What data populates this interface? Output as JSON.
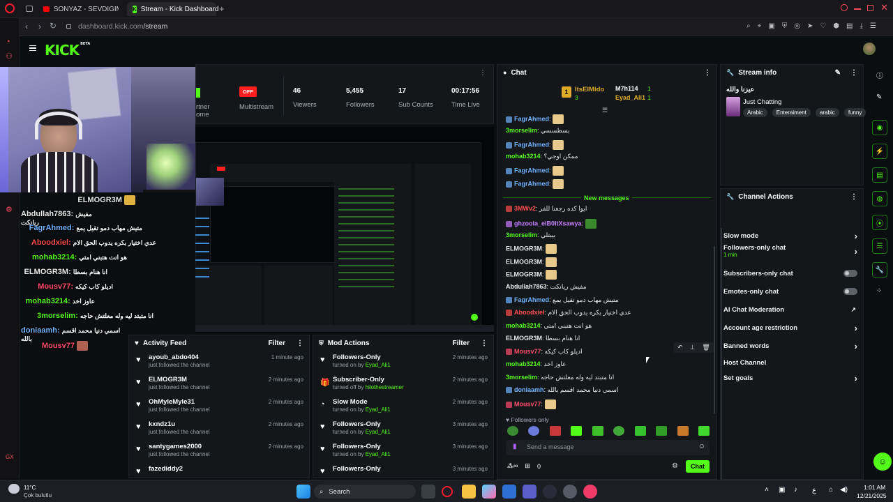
{
  "browser": {
    "tabs": [
      {
        "label": "SONYAZ - SEVDİĞİM (Ya"
      },
      {
        "label": "Stream - Kick Dashboard"
      }
    ],
    "url_host": "dashboard.kick.com",
    "url_path": "/stream"
  },
  "brand": {
    "logo": "KICK",
    "badge": "BETA",
    "accent": "#53fc18"
  },
  "stats": {
    "partial_label_1": "rtner",
    "partial_label_2": "ome",
    "multistream_badge": "OFF",
    "multistream_label": "Multistream",
    "viewers_value": "46",
    "viewers_label": "Viewers",
    "followers_value": "5,455",
    "followers_label": "Followers",
    "subs_value": "17",
    "subs_label": "Sub Counts",
    "time_value": "00:17:56",
    "time_label": "Time Live"
  },
  "overlay_chat": [
    {
      "user": "ELMOGR3M",
      "text": "",
      "color": "#e8e8e8"
    },
    {
      "user": "Abdullah7863",
      "text": "مفيش ريانكت",
      "color": "#e8e8e8"
    },
    {
      "user": "FagrAhmed",
      "text": "متيش مهاب دمو تقيل يمع",
      "color": "#6fb3ff"
    },
    {
      "user": "Aboodxiel",
      "text": "عدي اختيار بكره يدوب الحق الام",
      "color": "#ff4d4d"
    },
    {
      "user": "mohab3214",
      "text": "هو انت هتبني امتي",
      "color": "#53fc18"
    },
    {
      "user": "ELMOGR3M",
      "text": "انا هنام بسطا",
      "color": "#e8e8e8"
    },
    {
      "user": "Mousv77",
      "text": "اديلو كاب كيكه",
      "color": "#ff4d6d"
    },
    {
      "user": "mohab3214",
      "text": "عاوز اخد",
      "color": "#53fc18"
    },
    {
      "user": "3morselim",
      "text": "انا متبتد ليه وله معلتش حاجه",
      "color": "#53fc18"
    },
    {
      "user": "doniaamh",
      "text": "اسمي دنيا محمد اقسم بالله",
      "color": "#6fb3ff"
    },
    {
      "user": "Mousv77",
      "text": "",
      "color": "#ff4d6d"
    }
  ],
  "activity_feed": {
    "title": "Activity Feed",
    "filter": "Filter",
    "items": [
      {
        "name": "ayoub_abdo404",
        "sub": "just followed the channel",
        "time": "1 minute ago"
      },
      {
        "name": "ELMOGR3M",
        "sub": "just followed the channel",
        "time": "2 minutes ago"
      },
      {
        "name": "OhMyleMyle31",
        "sub": "just followed the channel",
        "time": "2 minutes ago"
      },
      {
        "name": "kxndz1u",
        "sub": "just followed the channel",
        "time": "2 minutes ago"
      },
      {
        "name": "santygames2000",
        "sub": "just followed the channel",
        "time": "2 minutes ago"
      },
      {
        "name": "fazediddy2",
        "sub": "",
        "time": ""
      }
    ]
  },
  "mod_actions": {
    "title": "Mod Actions",
    "filter": "Filter",
    "items": [
      {
        "name": "Followers-Only",
        "pre": "turned on by ",
        "by": "Eyad_Ali1",
        "time": "2 minutes ago"
      },
      {
        "name": "Subscriber-Only",
        "pre": "turned off by ",
        "by": "hilothestreamer",
        "time": "2 minutes ago"
      },
      {
        "name": "Slow Mode",
        "pre": "turned on by ",
        "by": "Eyad_Ali1",
        "time": "2 minutes ago"
      },
      {
        "name": "Followers-Only",
        "pre": "turned on by ",
        "by": "Eyad_Ali1",
        "time": "3 minutes ago"
      },
      {
        "name": "Followers-Only",
        "pre": "turned on by ",
        "by": "Eyad_Ali1",
        "time": "3 minutes ago"
      },
      {
        "name": "Followers-Only",
        "pre": "",
        "by": "",
        "time": "3 minutes ago"
      }
    ]
  },
  "chat": {
    "title": "Chat",
    "leader1": "ItsElMido",
    "leader1_count": "3",
    "leader2": "M7h114",
    "leader2_count": "1",
    "leader3": "Eyad_Ali1",
    "leader3_count": "1",
    "new_messages": "New messages",
    "messages": [
      {
        "user": "FagrAhmed",
        "text": "",
        "color": "#6fb3ff"
      },
      {
        "user": "3morselim",
        "text": "بسطسسي",
        "color": "#53fc18"
      },
      {
        "user": "FagrAhmed",
        "text": "",
        "color": "#6fb3ff"
      },
      {
        "user": "mohab3214",
        "text": "ممكن اوجي؟",
        "color": "#53fc18"
      },
      {
        "user": "FagrAhmed",
        "text": "",
        "color": "#6fb3ff"
      },
      {
        "user": "FagrAhmed",
        "text": "",
        "color": "#6fb3ff"
      },
      {
        "user": "3MWv2",
        "text": "ايوا كده رجعنا للفر",
        "color": "#ff4d4d"
      },
      {
        "user": "ghzoola_elB0ItXsawya",
        "text": "",
        "color": "#c77dff"
      },
      {
        "user": "3morselim",
        "text": "بيبتلي",
        "color": "#53fc18"
      },
      {
        "user": "ELMOGR3M",
        "text": "",
        "color": "#e8e8e8"
      },
      {
        "user": "ELMOGR3M",
        "text": "",
        "color": "#e8e8e8"
      },
      {
        "user": "ELMOGR3M",
        "text": "",
        "color": "#e8e8e8"
      },
      {
        "user": "Abdullah7863",
        "text": "مفيش ريانكت",
        "color": "#e8e8e8"
      },
      {
        "user": "FagrAhmed",
        "text": "متيش مهاب دمو تقيل يمع",
        "color": "#6fb3ff"
      },
      {
        "user": "Aboodxiel",
        "text": "عدي اختيار بكره يدوب الحق الام",
        "color": "#ff4d4d"
      },
      {
        "user": "mohab3214",
        "text": "هو انت هتبني امتي",
        "color": "#53fc18"
      },
      {
        "user": "ELMOGR3M",
        "text": "انا هنام بسطا",
        "color": "#e8e8e8"
      },
      {
        "user": "Mousv77",
        "text": "اديلو كاب كيكه",
        "color": "#ff4d6d"
      },
      {
        "user": "mohab3214",
        "text": "عاوز اخد",
        "color": "#53fc18"
      },
      {
        "user": "3morselim",
        "text": "انا متبتد ليه وله معلتش حاجه",
        "color": "#53fc18"
      },
      {
        "user": "doniaamh",
        "text": "اسمي دنيا محمد اقسم بالله",
        "color": "#6fb3ff"
      },
      {
        "user": "Mousv77",
        "text": "",
        "color": "#ff4d6d"
      }
    ],
    "followers_only": "Followers only",
    "input_placeholder": "Send a message",
    "points": "0",
    "send_label": "Chat"
  },
  "stream_info": {
    "title": "Stream info",
    "stream_title": "عيزنا والله",
    "category": "Just Chatting",
    "tags": [
      "Arabic",
      "Enteraiment",
      "arabic",
      "funny"
    ]
  },
  "channel_actions": {
    "title": "Channel Actions",
    "items": [
      {
        "label": "Slow mode",
        "sub": "",
        "control": "chevron"
      },
      {
        "label": "Followers-only chat",
        "sub": "1 min",
        "control": "chevron"
      },
      {
        "label": "Subscribers-only chat",
        "sub": "",
        "control": "toggle"
      },
      {
        "label": "Emotes-only chat",
        "sub": "",
        "control": "toggle"
      },
      {
        "label": "AI Chat Moderation",
        "sub": "",
        "control": "external"
      },
      {
        "label": "Account age restriction",
        "sub": "",
        "control": "chevron"
      },
      {
        "label": "Banned words",
        "sub": "",
        "control": "chevron"
      },
      {
        "label": "Host Channel",
        "sub": "",
        "control": "none"
      },
      {
        "label": "Set goals",
        "sub": "",
        "control": "chevron"
      }
    ]
  },
  "taskbar": {
    "weather_temp": "11°C",
    "weather_desc": "Çok bulutlu",
    "search": "Search",
    "time": "1:01 AM",
    "date": "12/21/2025",
    "lang": "ع"
  }
}
